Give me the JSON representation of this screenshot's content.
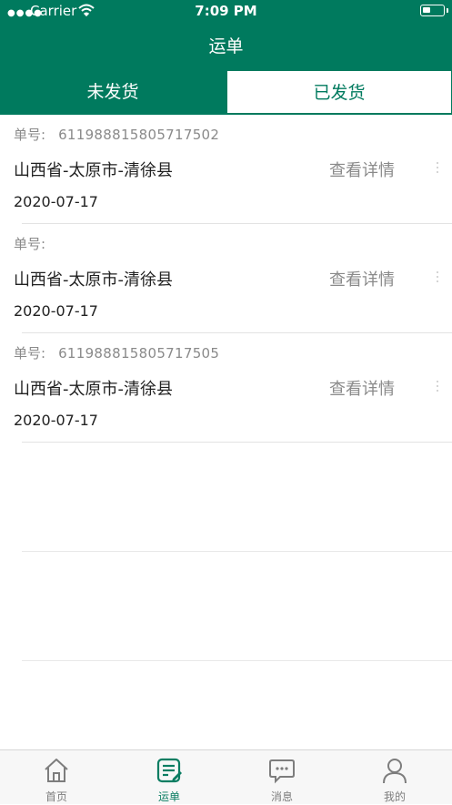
{
  "status_bar": {
    "carrier": "Carrier",
    "time": "7:09 PM"
  },
  "nav": {
    "title": "运单"
  },
  "tabs": [
    {
      "label": "未发货",
      "selected": false
    },
    {
      "label": "已发货",
      "selected": true
    }
  ],
  "orders": [
    {
      "order_label": "单号:",
      "order_number": "611988815805717502",
      "address": "山西省-太原市-清徐县",
      "detail_label": "查看详情",
      "date": "2020-07-17"
    },
    {
      "order_label": "单号:",
      "order_number": "",
      "address": "山西省-太原市-清徐县",
      "detail_label": "查看详情",
      "date": "2020-07-17"
    },
    {
      "order_label": "单号:",
      "order_number": "611988815805717505",
      "address": "山西省-太原市-清徐县",
      "detail_label": "查看详情",
      "date": "2020-07-17"
    }
  ],
  "tabbar": [
    {
      "label": "首页",
      "icon": "home-icon",
      "active": false
    },
    {
      "label": "运单",
      "icon": "waybill-icon",
      "active": true
    },
    {
      "label": "消息",
      "icon": "message-icon",
      "active": false
    },
    {
      "label": "我的",
      "icon": "profile-icon",
      "active": false
    }
  ],
  "colors": {
    "brand": "#007a5e",
    "active_tab_icon": "#0a7d62",
    "muted_text": "#8a8a8a"
  }
}
